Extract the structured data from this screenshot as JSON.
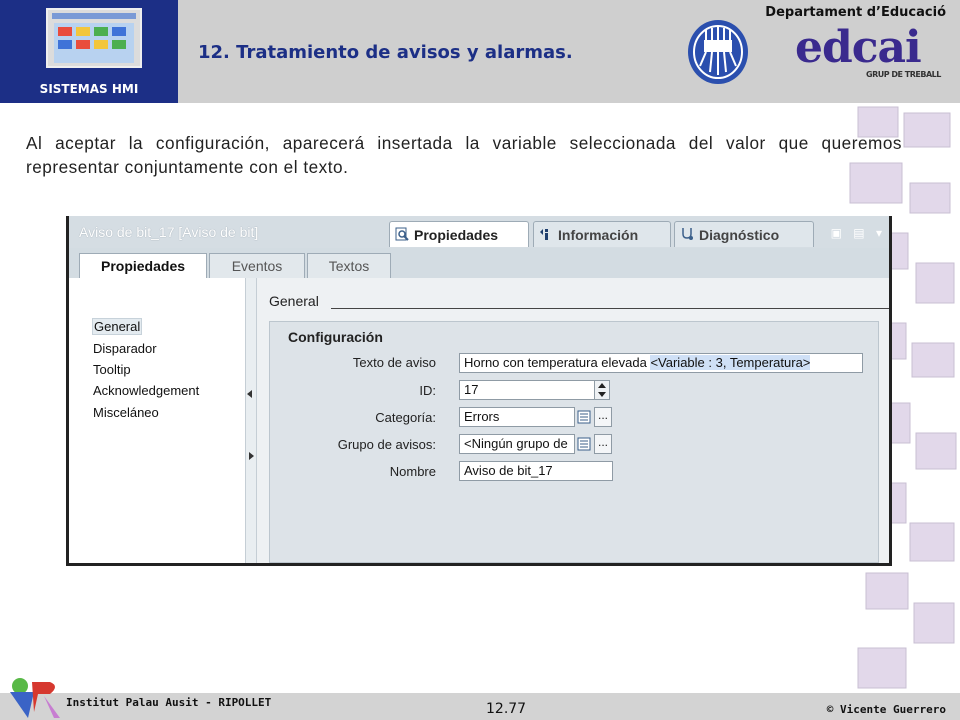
{
  "header": {
    "logo_label": "SISTEMAS HMI",
    "title": "12. Tratamiento de avisos y alarmas.",
    "department": "Departament d’Educació",
    "brand_logo_text": "edcai",
    "brand_logo_subtext": "GRUP DE TREBALL"
  },
  "body": {
    "text": "Al aceptar la configuración, aparecerá insertada la variable seleccionada del valor que queremos representar conjuntamente con el texto."
  },
  "panel": {
    "title": "Aviso de bit_17 [Aviso de bit]",
    "inspector_tabs": [
      {
        "label": "Propiedades",
        "icon": "properties-icon",
        "active": true
      },
      {
        "label": "Información",
        "icon": "info-icon",
        "active": false
      },
      {
        "label": "Diagnóstico",
        "icon": "diagnostics-icon",
        "active": false
      }
    ],
    "window_controls": "▣ ▤ ▾",
    "subtabs": [
      {
        "label": "Propiedades",
        "active": true
      },
      {
        "label": "Eventos",
        "active": false
      },
      {
        "label": "Textos",
        "active": false
      }
    ],
    "nav_items": [
      "General",
      "Disparador",
      "Tooltip",
      "Acknowledgement",
      "Misceláneo"
    ],
    "nav_selected": "General",
    "section_header": "General",
    "group_title": "Configuración",
    "fields": {
      "text_label": "Texto de aviso",
      "text_value": "Horno con temperatura elevada ",
      "text_variable": "<Variable : 3, Temperatura>",
      "id_label": "ID:",
      "id_value": "17",
      "category_label": "Categoría:",
      "category_value": "Errors",
      "group_label": "Grupo de avisos:",
      "group_value": "<Ningún grupo de",
      "name_label": "Nombre",
      "name_value": "Aviso de bit_17",
      "browse_label": "..."
    }
  },
  "footer": {
    "institution": "Institut Palau Ausit - RIPOLLET",
    "page_number": "12.77",
    "author": "© Vicente Guerrero"
  },
  "colors": {
    "header_gray": "#cfcfcf",
    "logo_blue": "#1c2f86",
    "title_blue": "#1c2f86",
    "highlight": "#cfe0f6"
  }
}
